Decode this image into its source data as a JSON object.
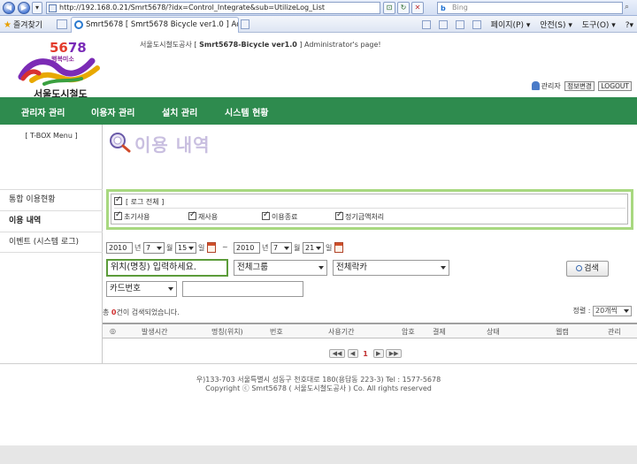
{
  "browser": {
    "url": "http://192.168.0.21/Smrt5678/?idx=Control_Integrate&sub=UtilizeLog_List",
    "search_placeholder": "Bing",
    "search_brand": "b",
    "favorites_label": "즐겨찾기",
    "tab_title": "Smrt5678 [ Smrt5678 Bicycle ver1.0 ] Adminis...",
    "cmd_page": "페이지(P) ▾",
    "cmd_safety": "안전(S) ▾",
    "cmd_tools": "도구(O) ▾",
    "cmd_help": "?▾"
  },
  "header": {
    "logo_number_a": "56",
    "logo_number_b": "78",
    "logo_tagline": "행복미소",
    "org_name": "서울도시철도",
    "site_title_prefix": "서울도시철도공사 [ ",
    "site_title_bold": "Smrt5678-Bicycle ver1.0",
    "site_title_suffix": " ] Administrator's page!",
    "admin_label": "관리자",
    "edit_info_label": "정보변경",
    "logout_label": "LOGOUT"
  },
  "main_nav": [
    {
      "label": "관리자 관리"
    },
    {
      "label": "이용자 관리"
    },
    {
      "label": "설치 관리"
    },
    {
      "label": "시스템 현황"
    }
  ],
  "sidebar": {
    "tbox_label": "[ T-BOX Menu ]",
    "items": [
      {
        "label": "통합 이용현황"
      },
      {
        "label": "이용 내역"
      },
      {
        "label": "이벤트 (시스템 로그)"
      }
    ]
  },
  "page": {
    "heading": "이용 내역"
  },
  "filters": {
    "all_label": "[ 로그 전체 ]",
    "options": [
      {
        "label": "초기사용"
      },
      {
        "label": "재사용"
      },
      {
        "label": "이용종료"
      },
      {
        "label": "정기금액처리"
      }
    ]
  },
  "date_range": {
    "start": {
      "year": "2010",
      "month": "7",
      "day": "15"
    },
    "end": {
      "year": "2010",
      "month": "7",
      "day": "21"
    },
    "year_unit": "년",
    "month_unit": "월",
    "day_unit": "일",
    "separator": "~"
  },
  "search": {
    "location_placeholder": "위치(명칭) 입력하세요.",
    "group_select": "전체그룹",
    "rack_select": "전체락카",
    "card_select": "카드번호",
    "button_label": "검색"
  },
  "results": {
    "prefix": "총 ",
    "count": "0",
    "suffix": "건이 검색되었습니다.",
    "sort_label": "정렬 :",
    "sort_value": "20개씩"
  },
  "table": {
    "headers": [
      "◎",
      "발생시간",
      "명칭(위치)",
      "번호",
      "사용기간",
      "암호",
      "결제",
      "상태",
      "웹캠",
      "관리"
    ]
  },
  "pager": {
    "first": "◀◀",
    "prev": "◀",
    "current": "1",
    "next": "▶",
    "last": "▶▶"
  },
  "footer": {
    "address": "우)133-703 서울특별시 성동구 천호대로 180(용답동 223-3) Tel : 1577-5678",
    "copyright": "Copyright ⓒ Smrt5678 ( 서울도시철도공사 ) Co. All rights reserved"
  }
}
